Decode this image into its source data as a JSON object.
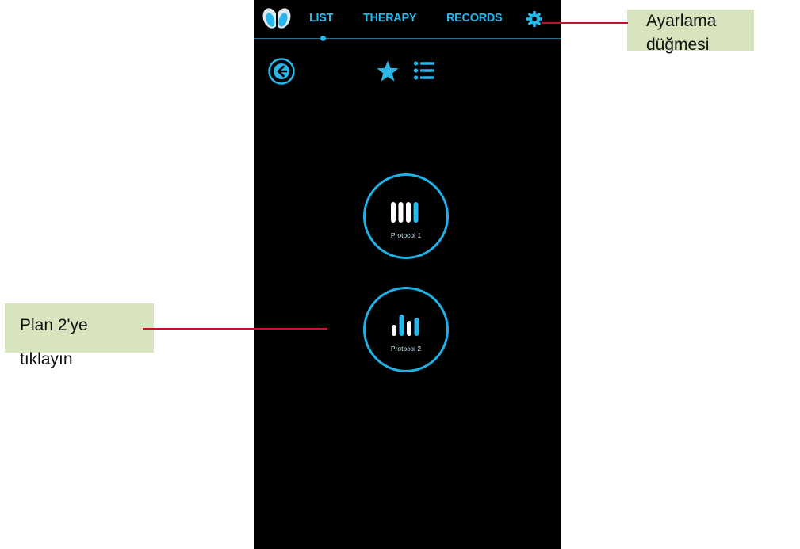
{
  "nav": {
    "tabs": [
      {
        "label": "LIST",
        "active": true
      },
      {
        "label": "THERAPY",
        "active": false
      },
      {
        "label": "RECORDS",
        "active": false
      }
    ],
    "settings_icon": "gear-icon",
    "logo_icon": "butterfly-logo-icon"
  },
  "toolbar": {
    "back_icon": "arrow-left-circle-icon",
    "favorites_icon": "star-icon",
    "list_icon": "list-icon"
  },
  "protocols": [
    {
      "label": "Protocol 1",
      "icon": "equal-bars-icon"
    },
    {
      "label": "Protocol 2",
      "icon": "rising-bars-icon"
    }
  ],
  "annotations": {
    "settings_callout": [
      "Ayarlama",
      "düğmesi"
    ],
    "plan2_callout": [
      "Plan 2'ye",
      "tıklayın"
    ]
  },
  "colors": {
    "accent": "#29b6e9",
    "background": "#000000",
    "callout_bg": "#d7e4bd",
    "pointer": "#c8102e"
  }
}
